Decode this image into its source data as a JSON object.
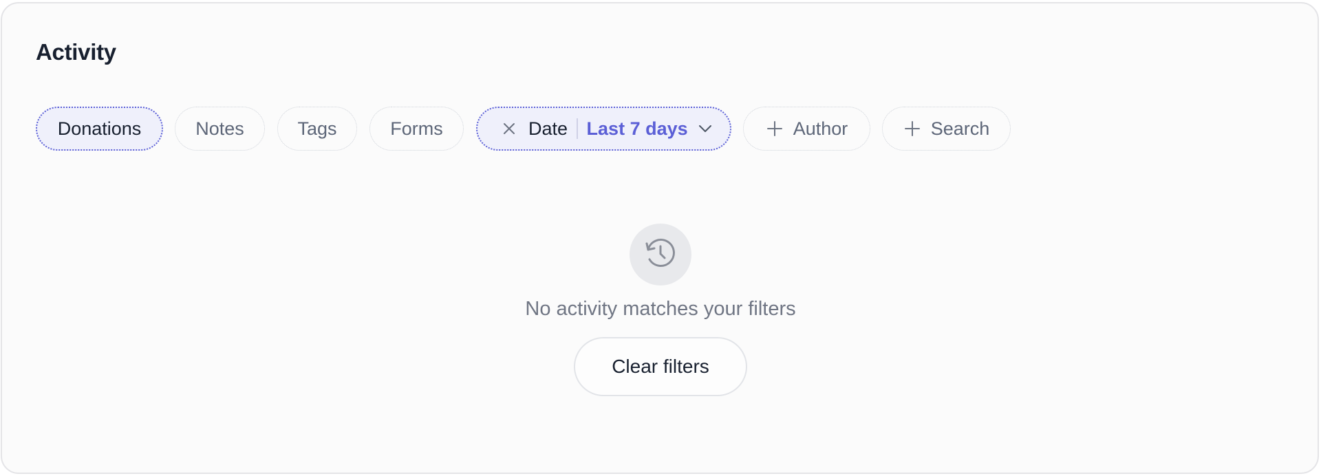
{
  "page": {
    "title": "Activity"
  },
  "filters": {
    "type_chips": [
      {
        "label": "Donations",
        "selected": true
      },
      {
        "label": "Notes",
        "selected": false
      },
      {
        "label": "Tags",
        "selected": false
      },
      {
        "label": "Forms",
        "selected": false
      }
    ],
    "date_filter": {
      "label": "Date",
      "value": "Last 7 days",
      "remove_icon": "close-icon",
      "dropdown_icon": "chevron-down-icon"
    },
    "add_chips": [
      {
        "label": "Author",
        "icon": "plus-icon"
      },
      {
        "label": "Search",
        "icon": "plus-icon"
      }
    ]
  },
  "empty_state": {
    "icon": "history-icon",
    "message": "No activity matches your filters",
    "action_label": "Clear filters"
  },
  "colors": {
    "accent": "#5b5fd6",
    "active_chip_bg": "#eff0fb",
    "text_primary": "#18202f",
    "text_muted": "#5d6678",
    "card_bg": "#fbfbfb"
  }
}
